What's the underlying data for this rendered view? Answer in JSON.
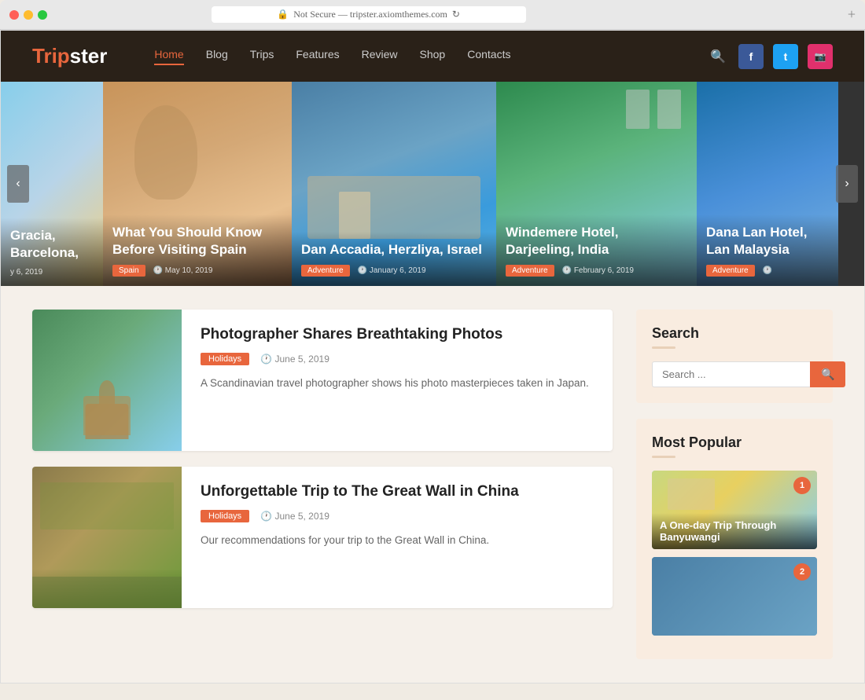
{
  "browser": {
    "url": "Not Secure — tripster.axiomthemes.com",
    "reload_title": "Reload"
  },
  "site": {
    "logo": {
      "trip": "Trip",
      "ster": "ster"
    },
    "nav": {
      "items": [
        {
          "label": "Home",
          "active": true
        },
        {
          "label": "Blog",
          "active": false
        },
        {
          "label": "Trips",
          "active": false
        },
        {
          "label": "Features",
          "active": false
        },
        {
          "label": "Review",
          "active": false
        },
        {
          "label": "Shop",
          "active": false
        },
        {
          "label": "Contacts",
          "active": false
        }
      ]
    },
    "social": {
      "facebook": "f",
      "twitter": "t",
      "instagram": "i"
    }
  },
  "slider": {
    "prev_label": "‹",
    "next_label": "›",
    "slides": [
      {
        "id": 1,
        "title": "Gracia, Barcelona,",
        "tag": "",
        "date": "y 6, 2019",
        "partial": true
      },
      {
        "id": 2,
        "title": "What You Should Know Before Visiting Spain",
        "tag": "Spain",
        "date": "May 10, 2019"
      },
      {
        "id": 3,
        "title": "Dan Accadia, Herzliya, Israel",
        "tag": "Adventure",
        "date": "January 6, 2019"
      },
      {
        "id": 4,
        "title": "Windemere Hotel, Darjeeling, India",
        "tag": "Adventure",
        "date": "February 6, 2019"
      },
      {
        "id": 5,
        "title": "Dana Lan Hotel, Lan Malaysia",
        "tag": "Adventure",
        "date": "",
        "partial": true
      }
    ]
  },
  "articles": [
    {
      "id": 1,
      "title": "Photographer Shares Breathtaking Photos",
      "tag": "Holidays",
      "date": "June 5, 2019",
      "excerpt": "A Scandinavian travel photographer shows his photo masterpieces taken in Japan."
    },
    {
      "id": 2,
      "title": "Unforgettable Trip to The Great Wall in China",
      "tag": "Holidays",
      "date": "June 5, 2019",
      "excerpt": "Our recommendations for your trip to the Great Wall in China."
    }
  ],
  "sidebar": {
    "search": {
      "title": "Search",
      "placeholder": "Search ...",
      "button_icon": "🔍"
    },
    "popular": {
      "title": "Most Popular",
      "items": [
        {
          "num": "1",
          "title": "A One-day Trip Through Banyuwangi"
        },
        {
          "num": "2",
          "title": ""
        }
      ]
    }
  }
}
